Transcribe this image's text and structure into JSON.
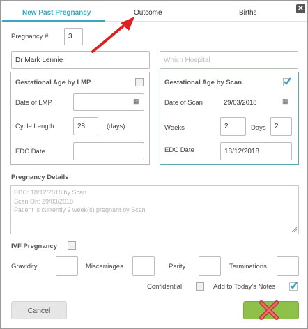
{
  "tabs": [
    {
      "label": "New Past Pregnancy",
      "active": true
    },
    {
      "label": "Outcome",
      "active": false
    },
    {
      "label": "Births",
      "active": false
    }
  ],
  "close_icon": "close-icon",
  "pregnancy_number": {
    "label": "Pregnancy #",
    "value": "3"
  },
  "doctor_field": {
    "value": "Dr Mark Lennie"
  },
  "hospital_field": {
    "placeholder": "Which Hospital"
  },
  "lmp_panel": {
    "title": "Gestational Age by LMP",
    "checked": false,
    "date_label": "Date of LMP",
    "date_value": "",
    "cycle_label": "Cycle Length",
    "cycle_value": "28",
    "cycle_unit": "(days)",
    "edc_label": "EDC Date",
    "edc_value": ""
  },
  "scan_panel": {
    "title": "Gestational Age by Scan",
    "checked": true,
    "date_label": "Date of Scan",
    "date_value": "29/03/2018",
    "weeks_label": "Weeks",
    "weeks_value": "2",
    "days_label": "Days",
    "days_value": "2",
    "edc_label": "EDC Date",
    "edc_value": "18/12/2018"
  },
  "pregnancy_details": {
    "label": "Pregnancy Details",
    "lines": [
      "EDC: 18/12/2018 by Scan",
      "Scan On: 29/03/2018",
      "Patient is currently 2 week(s) pregnant by Scan"
    ]
  },
  "ivf": {
    "label": "IVF Pregnancy",
    "checked": false
  },
  "counts": {
    "gravidity_label": "Gravidity",
    "miscarriages_label": "Miscarriages",
    "parity_label": "Parity",
    "terminations_label": "Terminations"
  },
  "confidential": {
    "label": "Confidential",
    "checked": false
  },
  "add_notes": {
    "label": "Add to Today's Notes",
    "checked": true
  },
  "buttons": {
    "cancel": "Cancel"
  },
  "colors": {
    "accent": "#3aa6c2",
    "save_green": "#8fc14a",
    "arrow_red": "#e02020"
  }
}
